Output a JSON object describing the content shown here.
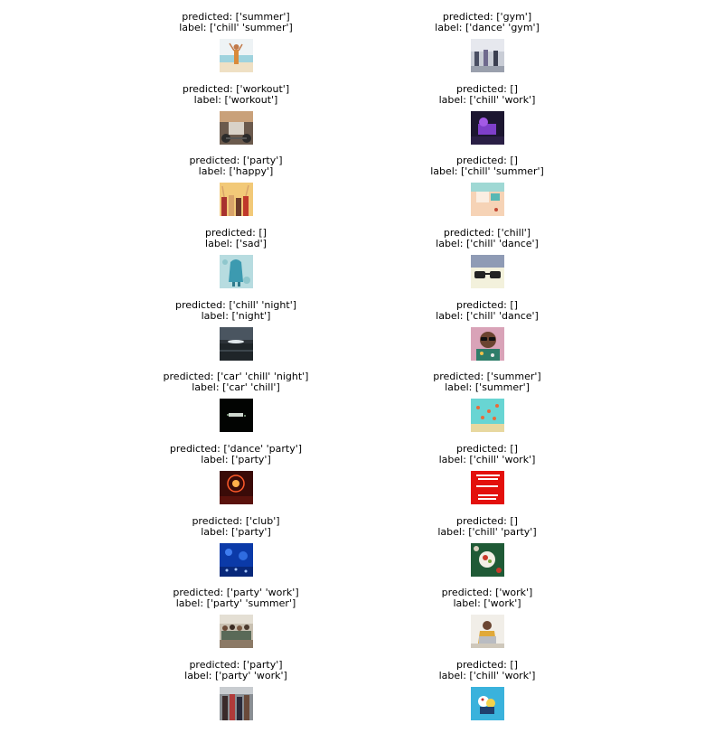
{
  "prefix": {
    "predicted": "predicted: ",
    "label": "label: "
  },
  "items": [
    {
      "predicted": "['summer']",
      "label": "['chill' 'summer']",
      "thumb": "beach-dancer"
    },
    {
      "predicted": "['gym']",
      "label": "['dance' 'gym']",
      "thumb": "gym-class"
    },
    {
      "predicted": "['workout']",
      "label": "['workout']",
      "thumb": "workout-weights"
    },
    {
      "predicted": "[]",
      "label": "['chill' 'work']",
      "thumb": "purple-desk"
    },
    {
      "predicted": "['party']",
      "label": "['happy']",
      "thumb": "happy-crowd"
    },
    {
      "predicted": "[]",
      "label": "['chill' 'summer']",
      "thumb": "summer-illustration"
    },
    {
      "predicted": "[]",
      "label": "['sad']",
      "thumb": "teal-figure"
    },
    {
      "predicted": "['chill']",
      "label": "['chill' 'dance']",
      "thumb": "sunglasses"
    },
    {
      "predicted": "['chill' 'night']",
      "label": "['night']",
      "thumb": "night-sea"
    },
    {
      "predicted": "[]",
      "label": "['chill' 'dance']",
      "thumb": "man-sunglasses"
    },
    {
      "predicted": "['car' 'chill' 'night']",
      "label": "['car' 'chill']",
      "thumb": "dark-night-car"
    },
    {
      "predicted": "['summer']",
      "label": "['summer']",
      "thumb": "pool-birds"
    },
    {
      "predicted": "['dance' 'party']",
      "label": "['party']",
      "thumb": "fireworks"
    },
    {
      "predicted": "[]",
      "label": "['chill' 'work']",
      "thumb": "red-poster"
    },
    {
      "predicted": "['club']",
      "label": "['party']",
      "thumb": "blue-club"
    },
    {
      "predicted": "[]",
      "label": "['chill' 'party']",
      "thumb": "food-table"
    },
    {
      "predicted": "['party' 'work']",
      "label": "['party' 'summer']",
      "thumb": "group-photo"
    },
    {
      "predicted": "['work']",
      "label": "['work']",
      "thumb": "laptop-woman"
    },
    {
      "predicted": "['party']",
      "label": "['party' 'work']",
      "thumb": "dancing-people"
    },
    {
      "predicted": "[]",
      "label": "['chill' 'work']",
      "thumb": "blue-illustration"
    }
  ]
}
